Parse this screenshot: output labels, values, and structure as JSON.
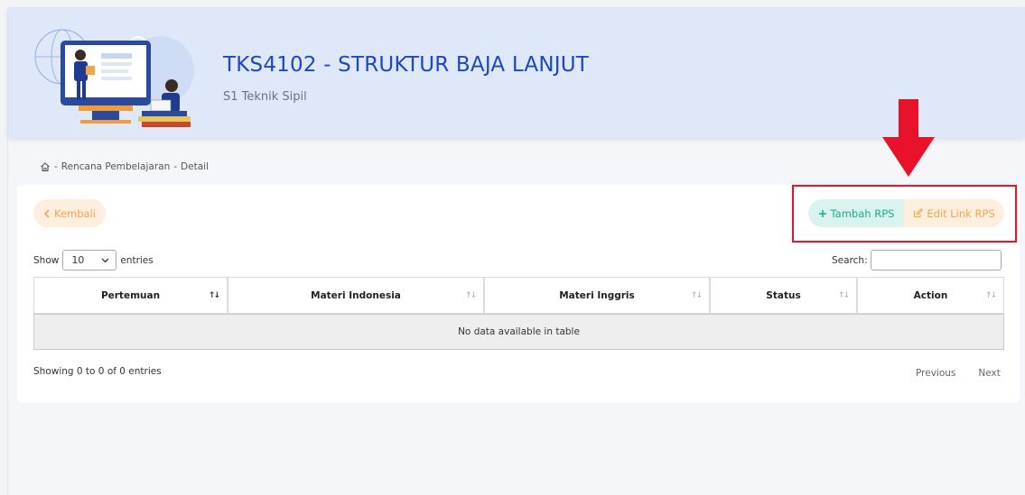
{
  "course": {
    "title": "TKS4102 - STRUKTUR BAJA LANJUT",
    "program": "S1 Teknik Sipil"
  },
  "breadcrumb": {
    "separator": "-",
    "items": [
      "Rencana Pembelajaran",
      "Detail"
    ]
  },
  "actions": {
    "back_label": "Kembali",
    "add_label": "Tambah RPS",
    "edit_label": "Edit Link RPS"
  },
  "table_controls": {
    "show_label": "Show",
    "entries_label": "entries",
    "page_length": "10",
    "search_label": "Search:",
    "search_value": ""
  },
  "table": {
    "columns": [
      "Pertemuan",
      "Materi Indonesia",
      "Materi Inggris",
      "Status",
      "Action"
    ],
    "empty_message": "No data available in table"
  },
  "footer": {
    "info": "Showing 0 to 0 of 0 entries",
    "previous_label": "Previous",
    "next_label": "Next"
  },
  "colors": {
    "title_blue": "#1c47c8",
    "header_bg": "#dfe8f8",
    "teal": "#1fa98e",
    "orange": "#f3a54e",
    "highlight_red": "#e8132a"
  }
}
